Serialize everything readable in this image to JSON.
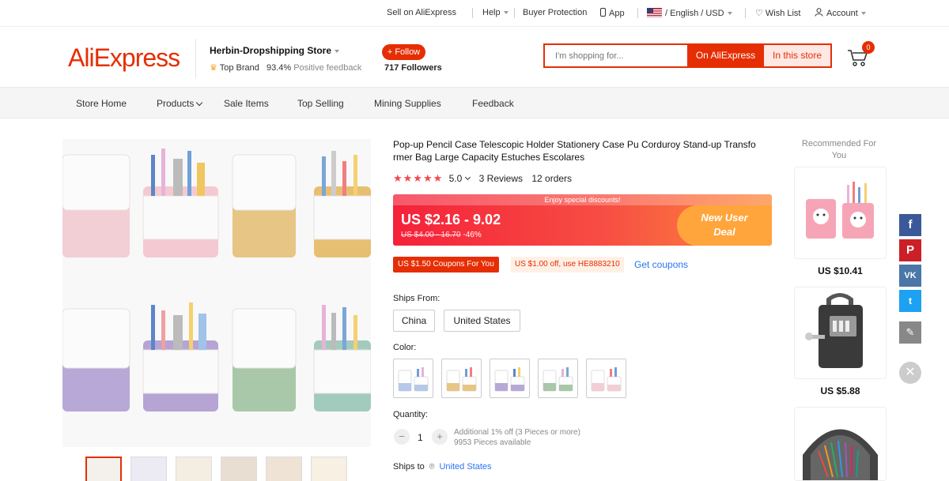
{
  "topbar": {
    "sell": "Sell on AliExpress",
    "help": "Help",
    "buyer_protection": "Buyer Protection",
    "app": "App",
    "lang_currency": "/ English / USD",
    "wish_list": "Wish List",
    "account": "Account"
  },
  "header": {
    "logo": "AliExpress",
    "store_name": "Herbin-Dropshipping Store",
    "top_brand": "Top Brand",
    "feedback_pct": "93.4%",
    "feedback_label": "Positive feedback",
    "follow": "+ Follow",
    "followers": "717 Followers",
    "search_placeholder": "I'm shopping for...",
    "search_on": "On AliExpress",
    "search_store": "In this store",
    "cart_count": "0"
  },
  "nav": [
    "Store Home",
    "Products",
    "Sale Items",
    "Top Selling",
    "Mining Supplies",
    "Feedback"
  ],
  "product": {
    "title": "Pop-up Pencil Case Telescopic Holder Stationery Case Pu Corduroy Stand-up Transfo rmer Bag Large Capacity Estuches Escolares",
    "stars": "★★★★★",
    "rating": "5.0",
    "reviews": "3 Reviews",
    "orders": "12 orders",
    "discount_banner": "Enjoy special discounts!",
    "price": "US $2.16 - 9.02",
    "old_price": "US $4.00 - 16.70",
    "discount_pct": "-46%",
    "new_user_line1": "New User",
    "new_user_line2": "Deal",
    "coupon1": "US $1.50 Coupons For You",
    "coupon2": "US $1.00 off, use HE8883210",
    "get_coupons": "Get coupons",
    "ships_from_label": "Ships From:",
    "ships_from_options": [
      "China",
      "United States"
    ],
    "color_label": "Color:",
    "quantity_label": "Quantity:",
    "quantity": "1",
    "qty_note1": "Additional 1% off (3 Pieces or more)",
    "qty_note2": "9953 Pieces available",
    "ships_to_label": "Ships to",
    "ships_to_value": "United States"
  },
  "recommended": {
    "title": "Recommended For You",
    "prices": [
      "US $10.41",
      "US $5.88"
    ]
  },
  "colors": {
    "accent": "#e62e04",
    "link": "#2874f0"
  }
}
